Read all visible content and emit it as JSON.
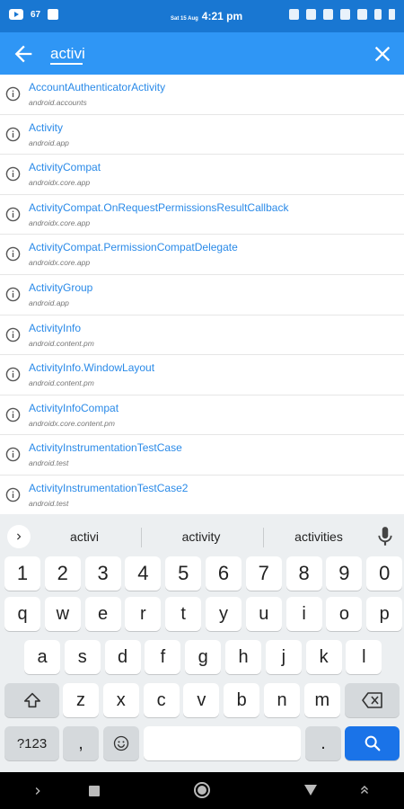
{
  "status_bar": {
    "notif_count": "67",
    "date": "Sat 15 Aug",
    "time": "4:21 pm"
  },
  "search": {
    "value": "activi"
  },
  "results": [
    {
      "name": "AccountAuthenticatorActivity",
      "package": "android.accounts"
    },
    {
      "name": "Activity",
      "package": "android.app"
    },
    {
      "name": "ActivityCompat",
      "package": "androidx.core.app"
    },
    {
      "name": "ActivityCompat.OnRequestPermissionsResultCallback",
      "package": "androidx.core.app"
    },
    {
      "name": "ActivityCompat.PermissionCompatDelegate",
      "package": "androidx.core.app"
    },
    {
      "name": "ActivityGroup",
      "package": "android.app"
    },
    {
      "name": "ActivityInfo",
      "package": "android.content.pm"
    },
    {
      "name": "ActivityInfo.WindowLayout",
      "package": "android.content.pm"
    },
    {
      "name": "ActivityInfoCompat",
      "package": "androidx.core.content.pm"
    },
    {
      "name": "ActivityInstrumentationTestCase",
      "package": "android.test"
    },
    {
      "name": "ActivityInstrumentationTestCase2",
      "package": "android.test"
    }
  ],
  "keyboard": {
    "suggestions": [
      "activi",
      "activity",
      "activities"
    ],
    "number_row": [
      "1",
      "2",
      "3",
      "4",
      "5",
      "6",
      "7",
      "8",
      "9",
      "0"
    ],
    "row1": [
      "q",
      "w",
      "e",
      "r",
      "t",
      "y",
      "u",
      "i",
      "o",
      "p"
    ],
    "row2": [
      "a",
      "s",
      "d",
      "f",
      "g",
      "h",
      "j",
      "k",
      "l"
    ],
    "row3": [
      "z",
      "x",
      "c",
      "v",
      "b",
      "n",
      "m"
    ],
    "symbols_key": "?123",
    "comma_key": ",",
    "period_key": "."
  },
  "colors": {
    "status_bar": "#1977d2",
    "app_bar": "#2f96f5",
    "link": "#2a8ae8",
    "enter_key": "#1a73e8"
  }
}
